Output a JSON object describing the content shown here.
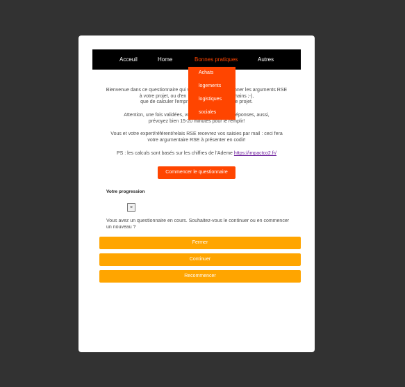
{
  "nav": {
    "items": [
      {
        "label": "Acceuil"
      },
      {
        "label": "Home"
      },
      {
        "label": "Bonnes pratiques"
      },
      {
        "label": "Autres"
      }
    ],
    "dropdown": [
      {
        "label": "Achats"
      },
      {
        "label": "logements"
      },
      {
        "label": "logistiques"
      },
      {
        "label": "sociales"
      }
    ]
  },
  "intro": {
    "line1": "Bienvenue dans ce questionnaire qui v",
    "line1b": "onner les arguments RSE",
    "line2": "à votre projet, ou d'en",
    "line2b": "rochains ;-),",
    "line3": "que de calculer l'empr",
    "line3b": "otre projet."
  },
  "attention": {
    "line1": "Attention, une fois validées, vous ne p",
    "line1b": "sur vos réponses, aussi,",
    "line2": "prévoyez bien 15-20 minutes pour le remplir!"
  },
  "expert": {
    "line1": "Vous et votre expert/référent/relais RSE recevrez vos saisies par mail : ceci fera",
    "line2": "votre argumentaire RSE à présenter en codir!"
  },
  "ps": {
    "text": "PS : les calculs sont basés sur les chiffres de l'Ademe ",
    "link": "https://impactco2.fr/"
  },
  "start_button": "Commencer le questionnaire",
  "progress": {
    "label": "Votre progression",
    "close": "×"
  },
  "modal": {
    "question": "Vous avez un questionnaire en cours. Souhaitez-vous le continuer ou en commencer un nouveau ?",
    "buttons": [
      {
        "label": "Fermer"
      },
      {
        "label": "Continuer"
      },
      {
        "label": "Recommencer"
      }
    ]
  },
  "colors": {
    "accent": "#ff4500",
    "button": "#ffa500",
    "background": "#323232",
    "nav": "#000000"
  }
}
